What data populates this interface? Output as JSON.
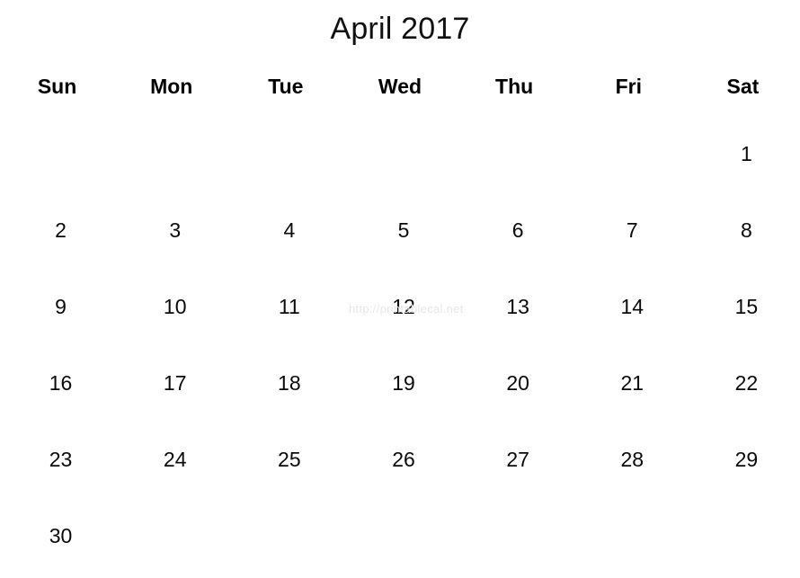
{
  "calendar": {
    "title": "April 2017",
    "month": "April",
    "year": "2017",
    "weekday_headers": [
      {
        "label": "Sun"
      },
      {
        "label": "Mon"
      },
      {
        "label": "Tue"
      },
      {
        "label": "Wed"
      },
      {
        "label": "Thu"
      },
      {
        "label": "Fri"
      },
      {
        "label": "Sat"
      }
    ],
    "weeks": [
      {
        "days": [
          "",
          "",
          "",
          "",
          "",
          "",
          "1"
        ]
      },
      {
        "days": [
          "2",
          "3",
          "4",
          "5",
          "6",
          "7",
          "8"
        ]
      },
      {
        "days": [
          "9",
          "10",
          "11",
          "12",
          "13",
          "14",
          "15"
        ]
      },
      {
        "days": [
          "16",
          "17",
          "18",
          "19",
          "20",
          "21",
          "22"
        ]
      },
      {
        "days": [
          "23",
          "24",
          "25",
          "26",
          "27",
          "28",
          "29"
        ]
      },
      {
        "days": [
          "30",
          "",
          "",
          "",
          "",
          "",
          ""
        ]
      }
    ],
    "watermark": "http://printablecal.net",
    "colors": {
      "background": "#ffffff",
      "text": "#000000",
      "watermark": "#e7e7e7"
    }
  }
}
